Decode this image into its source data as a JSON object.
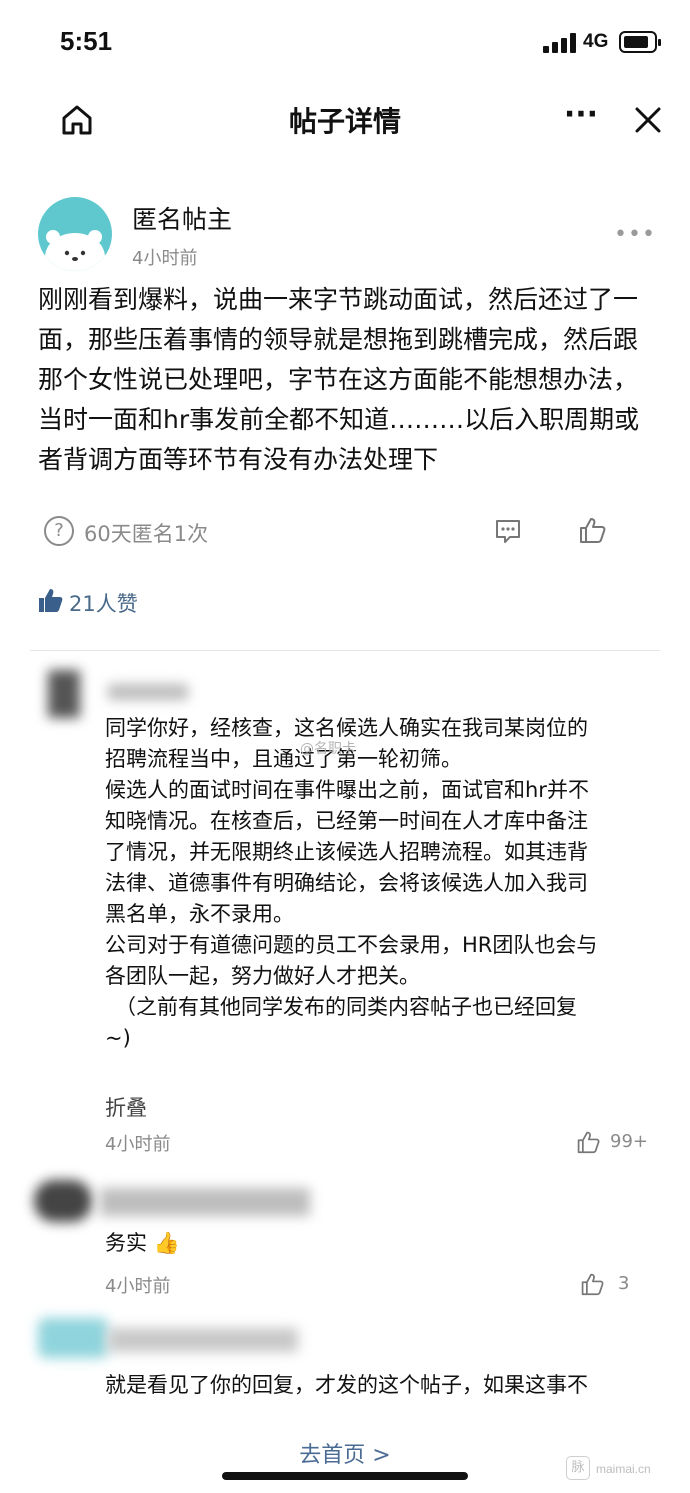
{
  "status": {
    "time": "5:51",
    "network": "4G"
  },
  "nav": {
    "title": "帖子详情"
  },
  "post": {
    "author": "匿名帖主",
    "time": "4小时前",
    "more": "•••",
    "body": "刚刚看到爆料，说曲一来字节跳动面试，然后还过了一面，那些压着事情的领导就是想拖到跳槽完成，然后跟那个女性说已处理吧，字节在这方面能不能想想办法，当时一面和hr事发前全都不知道………以后入职周期或者背调方面等环节有没有办法处理下",
    "anon_stats": "60天匿名1次",
    "likes": "21人赞"
  },
  "comments": [
    {
      "text_lines": [
        "同学你好，经核查，这名候选人确实在我司某岗位的",
        "招聘流程当中，且通过了第一轮初筛。",
        "候选人的面试时间在事件曝出之前，面试官和hr并不",
        "知晓情况。在核查后，已经第一时间在人才库中备注",
        "了情况，并无限期终止该候选人招聘流程。如其违背",
        "法律、道德事件有明确结论，会将该候选人加入我司",
        "黑名单，永不录用。",
        "公司对于有道德问题的员工不会录用，HR团队也会与",
        "各团队一起，努力做好人才把关。",
        "（之前有其他同学发布的同类内容帖子也已经回复",
        "~)"
      ],
      "fold": "折叠",
      "time": "4小时前",
      "likes": "99+"
    },
    {
      "text": "务实 👍",
      "time": "4小时前",
      "likes": "3"
    },
    {
      "text": "就是看见了你的回复，才发的这个帖子，如果这事不"
    }
  ],
  "watermark": "@名职卡",
  "footer": {
    "home_link": "去首页 >",
    "site": "maimai.cn",
    "site_badge": "脉"
  },
  "colors": {
    "avatar_bg": "#5fc8cf",
    "link": "#4a6b94",
    "muted": "#8a8a8a"
  }
}
